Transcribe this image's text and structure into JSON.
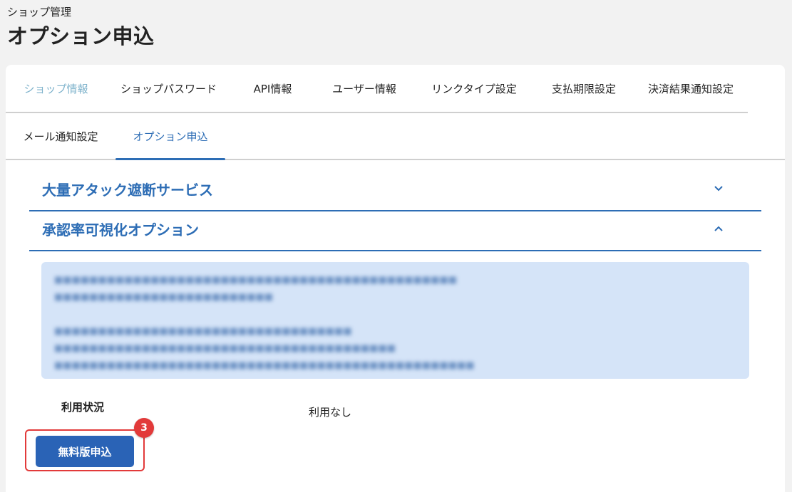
{
  "header": {
    "breadcrumb": "ショップ管理",
    "title": "オプション申込"
  },
  "tabs": {
    "row1": [
      {
        "label": "ショップ情報"
      },
      {
        "label": "ショップパスワード"
      },
      {
        "label": "API情報"
      },
      {
        "label": "ユーザー情報"
      },
      {
        "label": "リンクタイプ設定"
      },
      {
        "label": "支払期限設定"
      },
      {
        "label": "決済結果通知設定"
      }
    ],
    "row2": [
      {
        "label": "メール通知設定"
      },
      {
        "label": "オプション申込"
      }
    ]
  },
  "accordions": [
    {
      "title": "大量アタック遮断サービス",
      "icon": "chevron-down-icon"
    },
    {
      "title": "承認率可視化オプション",
      "icon": "chevron-up-icon"
    }
  ],
  "status": {
    "label": "利用状況",
    "value": "利用なし"
  },
  "apply_button": {
    "label": "無料版申込"
  },
  "badge": {
    "value": "3"
  },
  "colors": {
    "accent": "#2d6db5",
    "button": "#2a63b6",
    "info_bg": "#d5e4f8",
    "highlight": "#e23a3a"
  }
}
